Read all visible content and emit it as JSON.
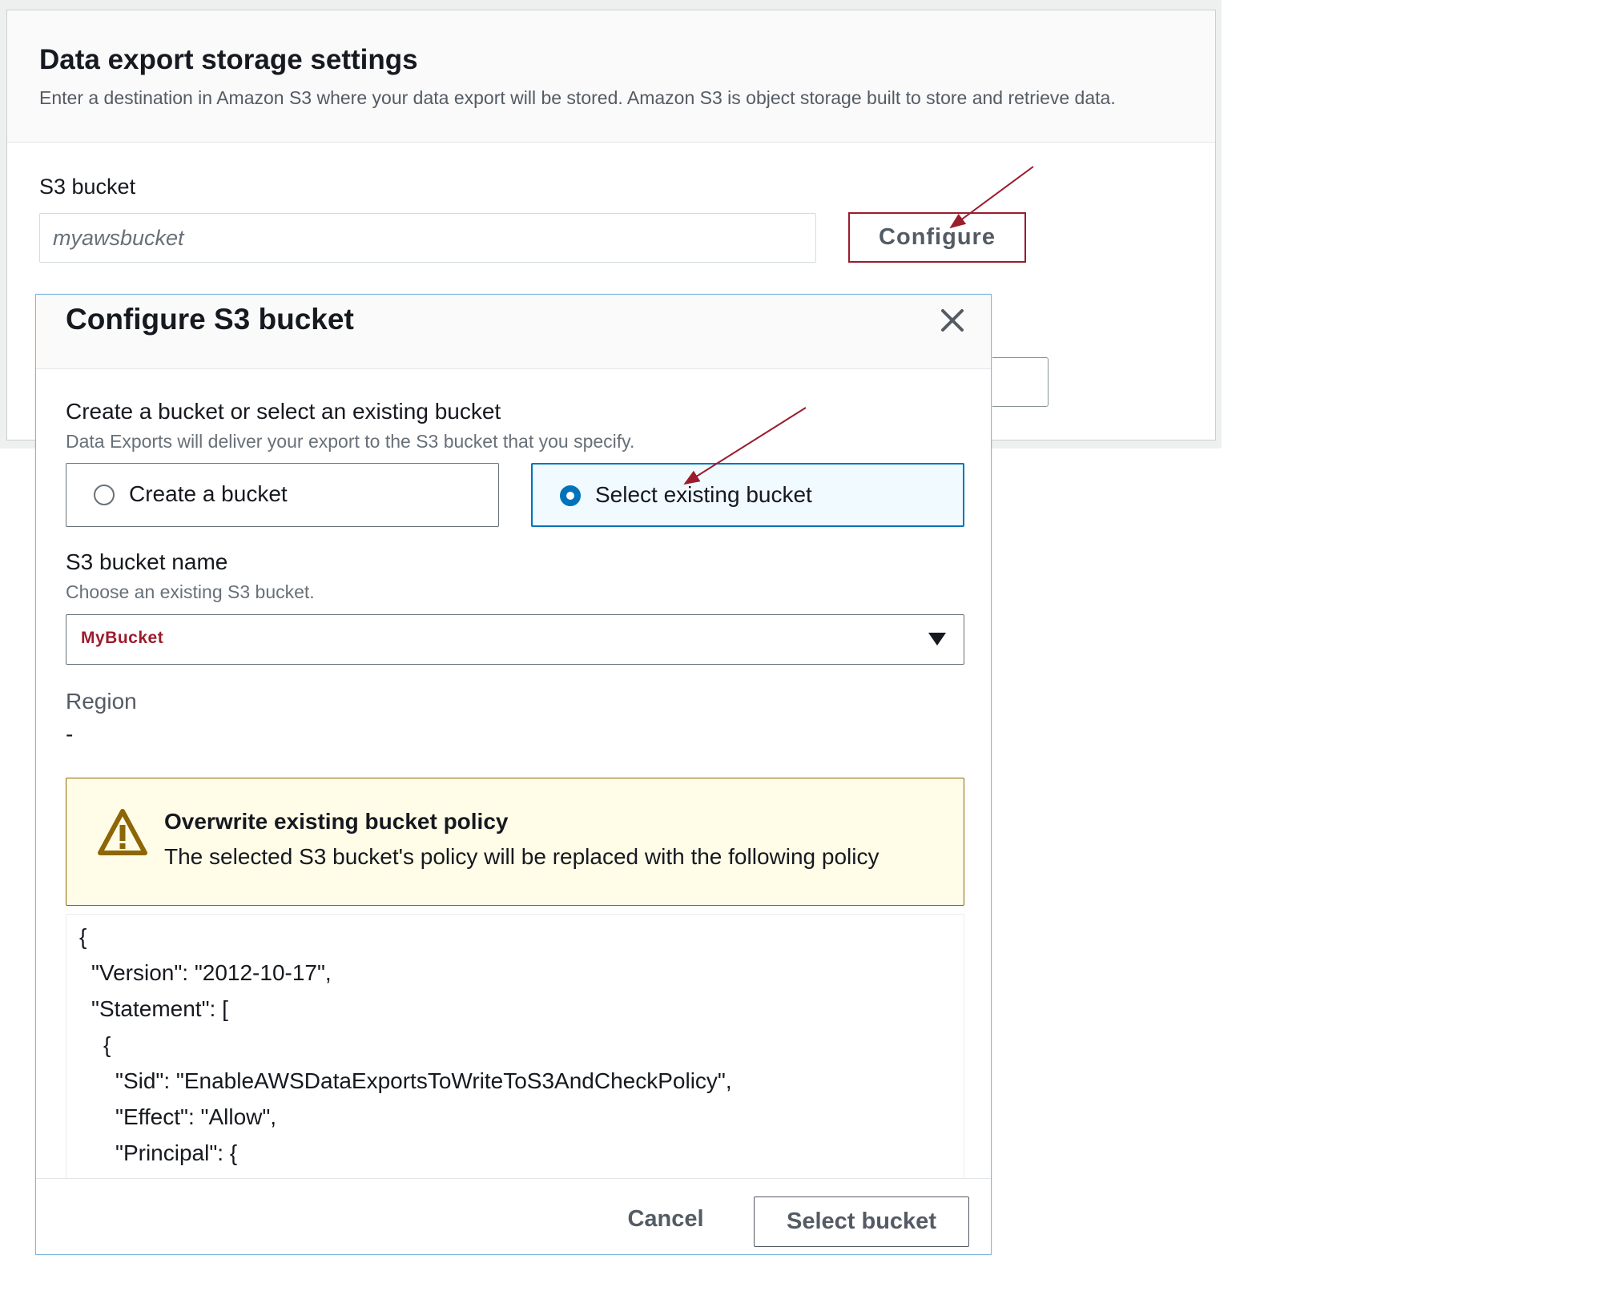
{
  "settings": {
    "title": "Data export storage settings",
    "description": "Enter a destination in Amazon S3 where your data export will be stored. Amazon S3 is object storage built to store and retrieve data.",
    "s3_bucket_label": "S3 bucket",
    "s3_bucket_placeholder": "myawsbucket",
    "configure_label": "Configure"
  },
  "modal": {
    "title": "Configure S3 bucket",
    "close_icon": "close-icon",
    "choose_label": "Create a bucket or select an existing bucket",
    "choose_description": "Data Exports will deliver your export to the S3 bucket that you specify.",
    "options": [
      {
        "label": "Create a bucket",
        "selected": false
      },
      {
        "label": "Select existing bucket",
        "selected": true
      }
    ],
    "bucket_name_label": "S3 bucket name",
    "bucket_name_description": "Choose an existing S3 bucket.",
    "bucket_name_value": "MyBucket",
    "region_label": "Region",
    "region_value": "-",
    "alert": {
      "icon": "warning-icon",
      "title": "Overwrite existing bucket policy",
      "body": "The selected S3 bucket's policy will be replaced with the following policy"
    },
    "policy_lines": [
      "{",
      "\"Version\": \"2012-10-17\",",
      "\"Statement\": [",
      "{",
      "\"Sid\": \"EnableAWSDataExportsToWriteToS3AndCheckPolicy\",",
      "\"Effect\": \"Allow\",",
      "\"Principal\": {"
    ],
    "cancel_label": "Cancel",
    "select_label": "Select bucket"
  },
  "colors": {
    "accent_blue": "#0073bb",
    "annotation_red": "#9b1c2c",
    "warning_border": "#8d6605",
    "warning_bg": "#fffce8"
  }
}
